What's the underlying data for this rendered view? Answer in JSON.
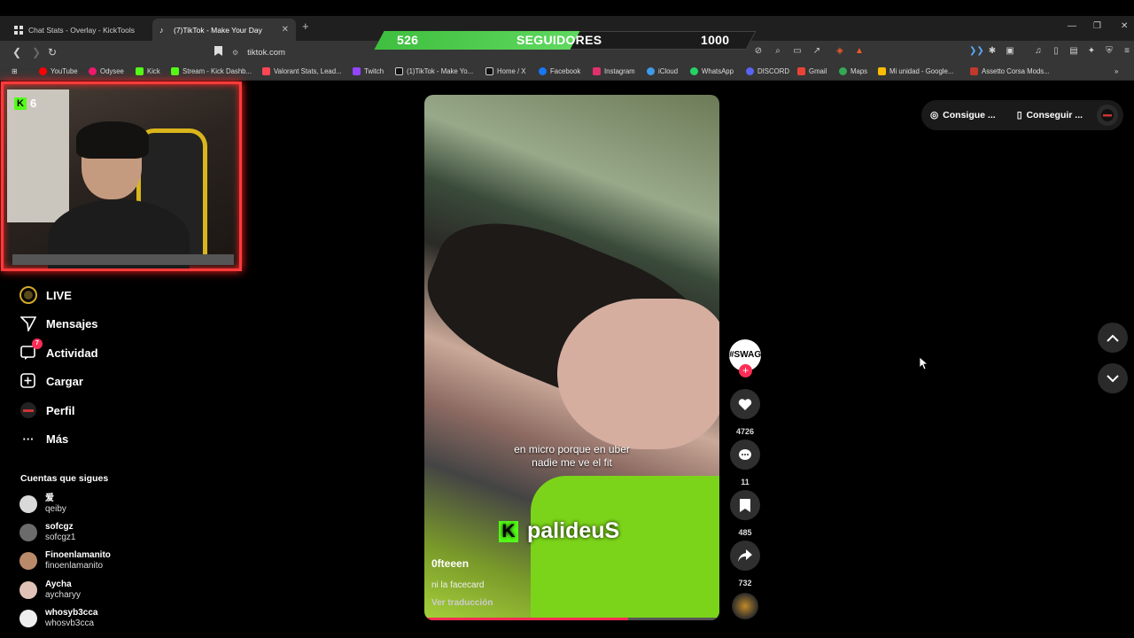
{
  "browser": {
    "tabs": [
      {
        "title": "Chat Stats - Overlay - KickTools"
      },
      {
        "title": "(7)TikTok - Make Your Day"
      }
    ],
    "url": "tiktok.com",
    "bookmarks": [
      {
        "label": "YouTube",
        "color": "#ff0000"
      },
      {
        "label": "Odysee",
        "color": "#ef1970"
      },
      {
        "label": "Kick",
        "color": "#53fc18"
      },
      {
        "label": "Stream - Kick Dashb...",
        "color": "#53fc18"
      },
      {
        "label": "Valorant Stats, Lead...",
        "color": "#ff4655"
      },
      {
        "label": "Twitch",
        "color": "#9146ff"
      },
      {
        "label": "(1)TikTok - Make Yo...",
        "color": "#000000"
      },
      {
        "label": "Home / X",
        "color": "#000000"
      },
      {
        "label": "Facebook",
        "color": "#1877f2"
      },
      {
        "label": "Instagram",
        "color": "#e1306c"
      },
      {
        "label": "iCloud",
        "color": "#3d9be9"
      },
      {
        "label": "WhatsApp",
        "color": "#25d366"
      },
      {
        "label": "DISCORD",
        "color": "#5865f2"
      },
      {
        "label": "Gmail",
        "color": "#ea4335"
      },
      {
        "label": "Maps",
        "color": "#34a853"
      },
      {
        "label": "Mi unidad - Google...",
        "color": "#fbbc04"
      },
      {
        "label": "Assetto Corsa Mods...",
        "color": "#c0392b"
      }
    ]
  },
  "overlay": {
    "current": "526",
    "label": "SEGUIDORES",
    "goal": "1000",
    "progress_fraction": 0.526,
    "webcam_badge_count": "6"
  },
  "sidebar": {
    "nav": [
      {
        "label": "LIVE"
      },
      {
        "label": "Mensajes"
      },
      {
        "label": "Actividad",
        "badge": "7"
      },
      {
        "label": "Cargar"
      },
      {
        "label": "Perfil"
      },
      {
        "label": "Más"
      }
    ],
    "following_title": "Cuentas que sigues",
    "following": [
      {
        "name": "爱",
        "handle": "qeiby"
      },
      {
        "name": "sofcgz",
        "handle": "sofcgz1"
      },
      {
        "name": "Finoenlamanito",
        "handle": "finoenlamanito"
      },
      {
        "name": "Aycha",
        "handle": "aycharyy"
      },
      {
        "name": "whosyb3cca",
        "handle": "whosvb3cca"
      }
    ]
  },
  "video": {
    "caption_line1": "en micro porque en uber",
    "caption_line2": "nadie me ve el fit",
    "watermark": "palideuS",
    "author": "0fteeen",
    "description": "ni la facecard",
    "translate": "Ver traducción",
    "progress_fraction": 0.69,
    "creator_avatar_text": "#SWAG"
  },
  "actions": {
    "likes": "4726",
    "comments": "11",
    "saves": "485",
    "shares": "732"
  },
  "topright": {
    "item1": "Consigue ...",
    "item2": "Conseguir ..."
  }
}
